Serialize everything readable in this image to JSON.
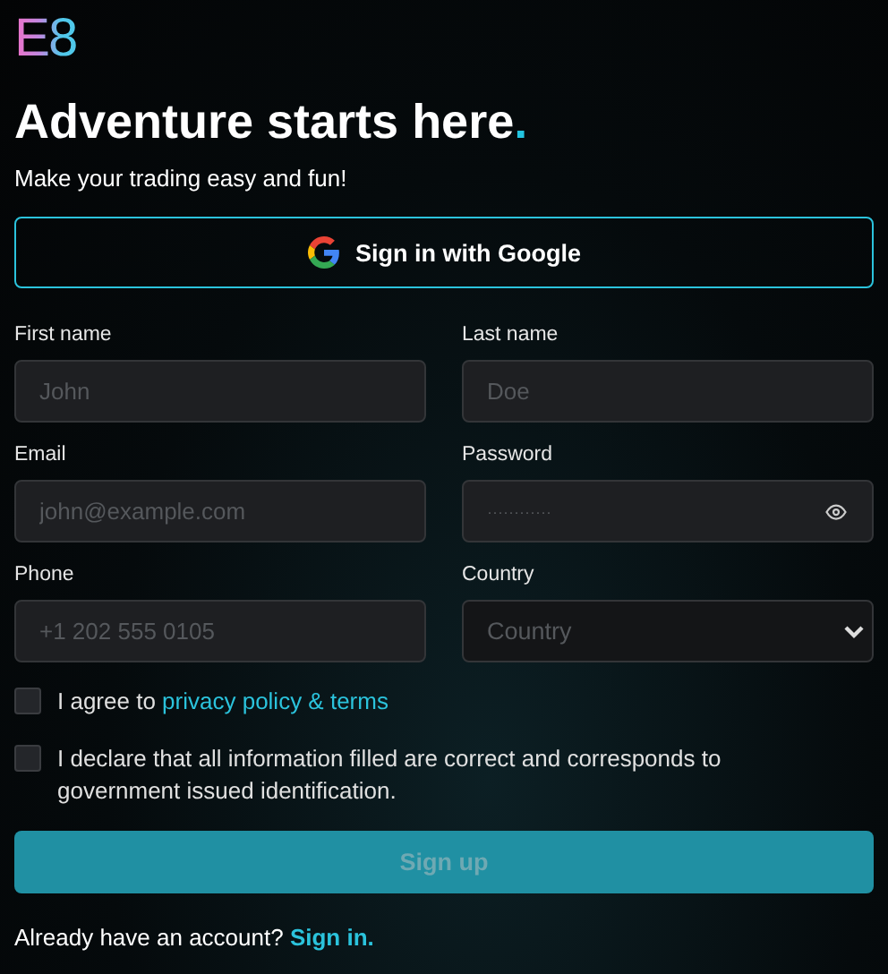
{
  "logo": {
    "text": "E8"
  },
  "title": "Adventure starts here",
  "title_accent": ".",
  "subtitle": "Make your trading easy and fun!",
  "google_button": {
    "label": "Sign in with Google"
  },
  "fields": [
    {
      "label": "First name",
      "placeholder": "John",
      "kind": "text"
    },
    {
      "label": "Last name",
      "placeholder": "Doe",
      "kind": "text"
    },
    {
      "label": "Email",
      "placeholder": "john@example.com",
      "kind": "text"
    },
    {
      "label": "Password",
      "placeholder": "············",
      "kind": "password"
    },
    {
      "label": "Phone",
      "placeholder": "+1 202 555 0105",
      "kind": "text"
    },
    {
      "label": "Country",
      "placeholder": "Country",
      "kind": "select"
    }
  ],
  "agreements": [
    {
      "text": "I agree to ",
      "link": "privacy policy & terms",
      "checked": false
    },
    {
      "text": "I declare that all information filled are correct and corresponds to government issued identification.",
      "checked": false
    }
  ],
  "submit": {
    "label": "Sign up",
    "disabled": true
  },
  "footer": {
    "text": "Already have an account? ",
    "link": "Sign in."
  }
}
